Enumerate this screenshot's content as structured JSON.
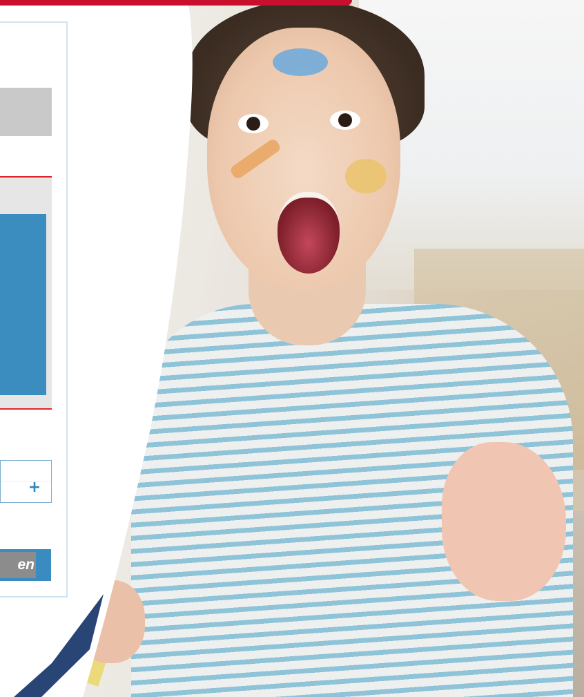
{
  "colors": {
    "accent": "#c8102e",
    "blue": "#3b8cbf",
    "panel_gray": "#c9c9c9",
    "button_gray": "#8c8c8c",
    "card_border": "#cfe4f2"
  },
  "form": {
    "add_icon": "+",
    "action_label": "en"
  },
  "icons": {
    "plus": "plus-icon"
  }
}
